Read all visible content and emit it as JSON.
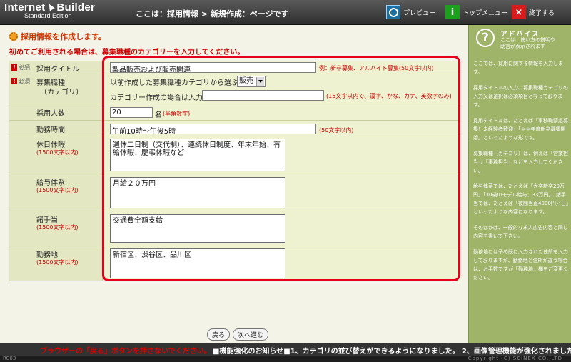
{
  "app": {
    "logo_line1a": "Internet",
    "logo_line1b": "Builder",
    "logo_line2": "Standard Edition",
    "breadcrumb": "ここは：採用情報 > 新規作成：ページです",
    "preview_label": "プレビュー",
    "topmenu_label": "トップメニュー",
    "exit_label": "終了する",
    "topmenu_glyph": "i",
    "exit_glyph": "×"
  },
  "page": {
    "heading": "採用情報を作成します。",
    "subnote": "初めてご利用される場合は、募集職種のカテゴリーを入力してください。"
  },
  "form": {
    "required_label": "必須",
    "title": {
      "label": "採用タイトル",
      "value": "製品販売および販売関連",
      "hint": "例：新卒募集、アルバイト募集(50文字以内)"
    },
    "category": {
      "label": "募集職種",
      "label2": "（カテゴリ）",
      "select_prompt": "以前作成した募集職種カテゴリから選ぶ",
      "select_value": "販売",
      "create_prompt": "カテゴリー作成の場合は入力",
      "create_value": "",
      "create_hint": "(15文字以内で、漢字、かな、カナ、英数字のみ)"
    },
    "headcount": {
      "label": "採用人数",
      "value": "20",
      "unit": "名",
      "hint": "(半角数字)"
    },
    "hours": {
      "label": "勤務時間",
      "value": "午前10時〜午後5時",
      "hint": "(50文字以内)"
    },
    "holidays": {
      "label": "休日休暇",
      "limit": "(1500文字以内)",
      "value": "週休二日制（交代制）、連続休日制度、年末年始、有給休暇、慶弔休暇など"
    },
    "salary": {
      "label": "給与体系",
      "limit": "(1500文字以内)",
      "value": "月給２０万円"
    },
    "allowance": {
      "label": "諸手当",
      "limit": "(1500文字以内)",
      "value": "交通費全額支給"
    },
    "location": {
      "label": "勤務地",
      "limit": "(1500文字以内)",
      "value": "新宿区、渋谷区、品川区"
    }
  },
  "buttons": {
    "back": "戻る",
    "next": "次へ進む"
  },
  "advice": {
    "title": "アドバイス",
    "sub1": "ここは、使い方の説明や",
    "sub2": "助言が表示されます",
    "p1": "ここでは、採用に関する情報を入力します。",
    "p2": "採用タイトルの入力、募集職種カテゴリの入力又は選択は必須項目となっております。",
    "p3": "採用タイトルは、たとえば「事務職緊急募集！未経験者歓迎」「＊＊年度新卒募集開始」といったような形です。",
    "p4": "募集職種（カテゴリ）は、例えば「営業担当」、「事務担当」などを入力してください。",
    "p5": "給与体系では、たとえば「大卒新卒20万円」「30歳のモデル給与：33万円」、諸手当では、たとえば「夜間当直4000円／日」といったような内容になります。",
    "p6": "そのほかは、一般的な求人広告内容と同じ内容を書いて下さい。",
    "p7": "勤務地には予め既に入力された住所を入力しておりますが、勤務地と住所が違う場合は、お手数ですが「勤務地」欄をご変更ください。"
  },
  "footer": {
    "warning": "ブラウザーの「戻る」ボタンを押さないでください。",
    "news": "■機能強化のお知らせ■1、カテゴリの並び替えができるようになりました。 2、画像管理機能が強化されました。 3",
    "version": "RC03",
    "copyright": "Copyright (C) SCINEX CO.,LTD"
  }
}
